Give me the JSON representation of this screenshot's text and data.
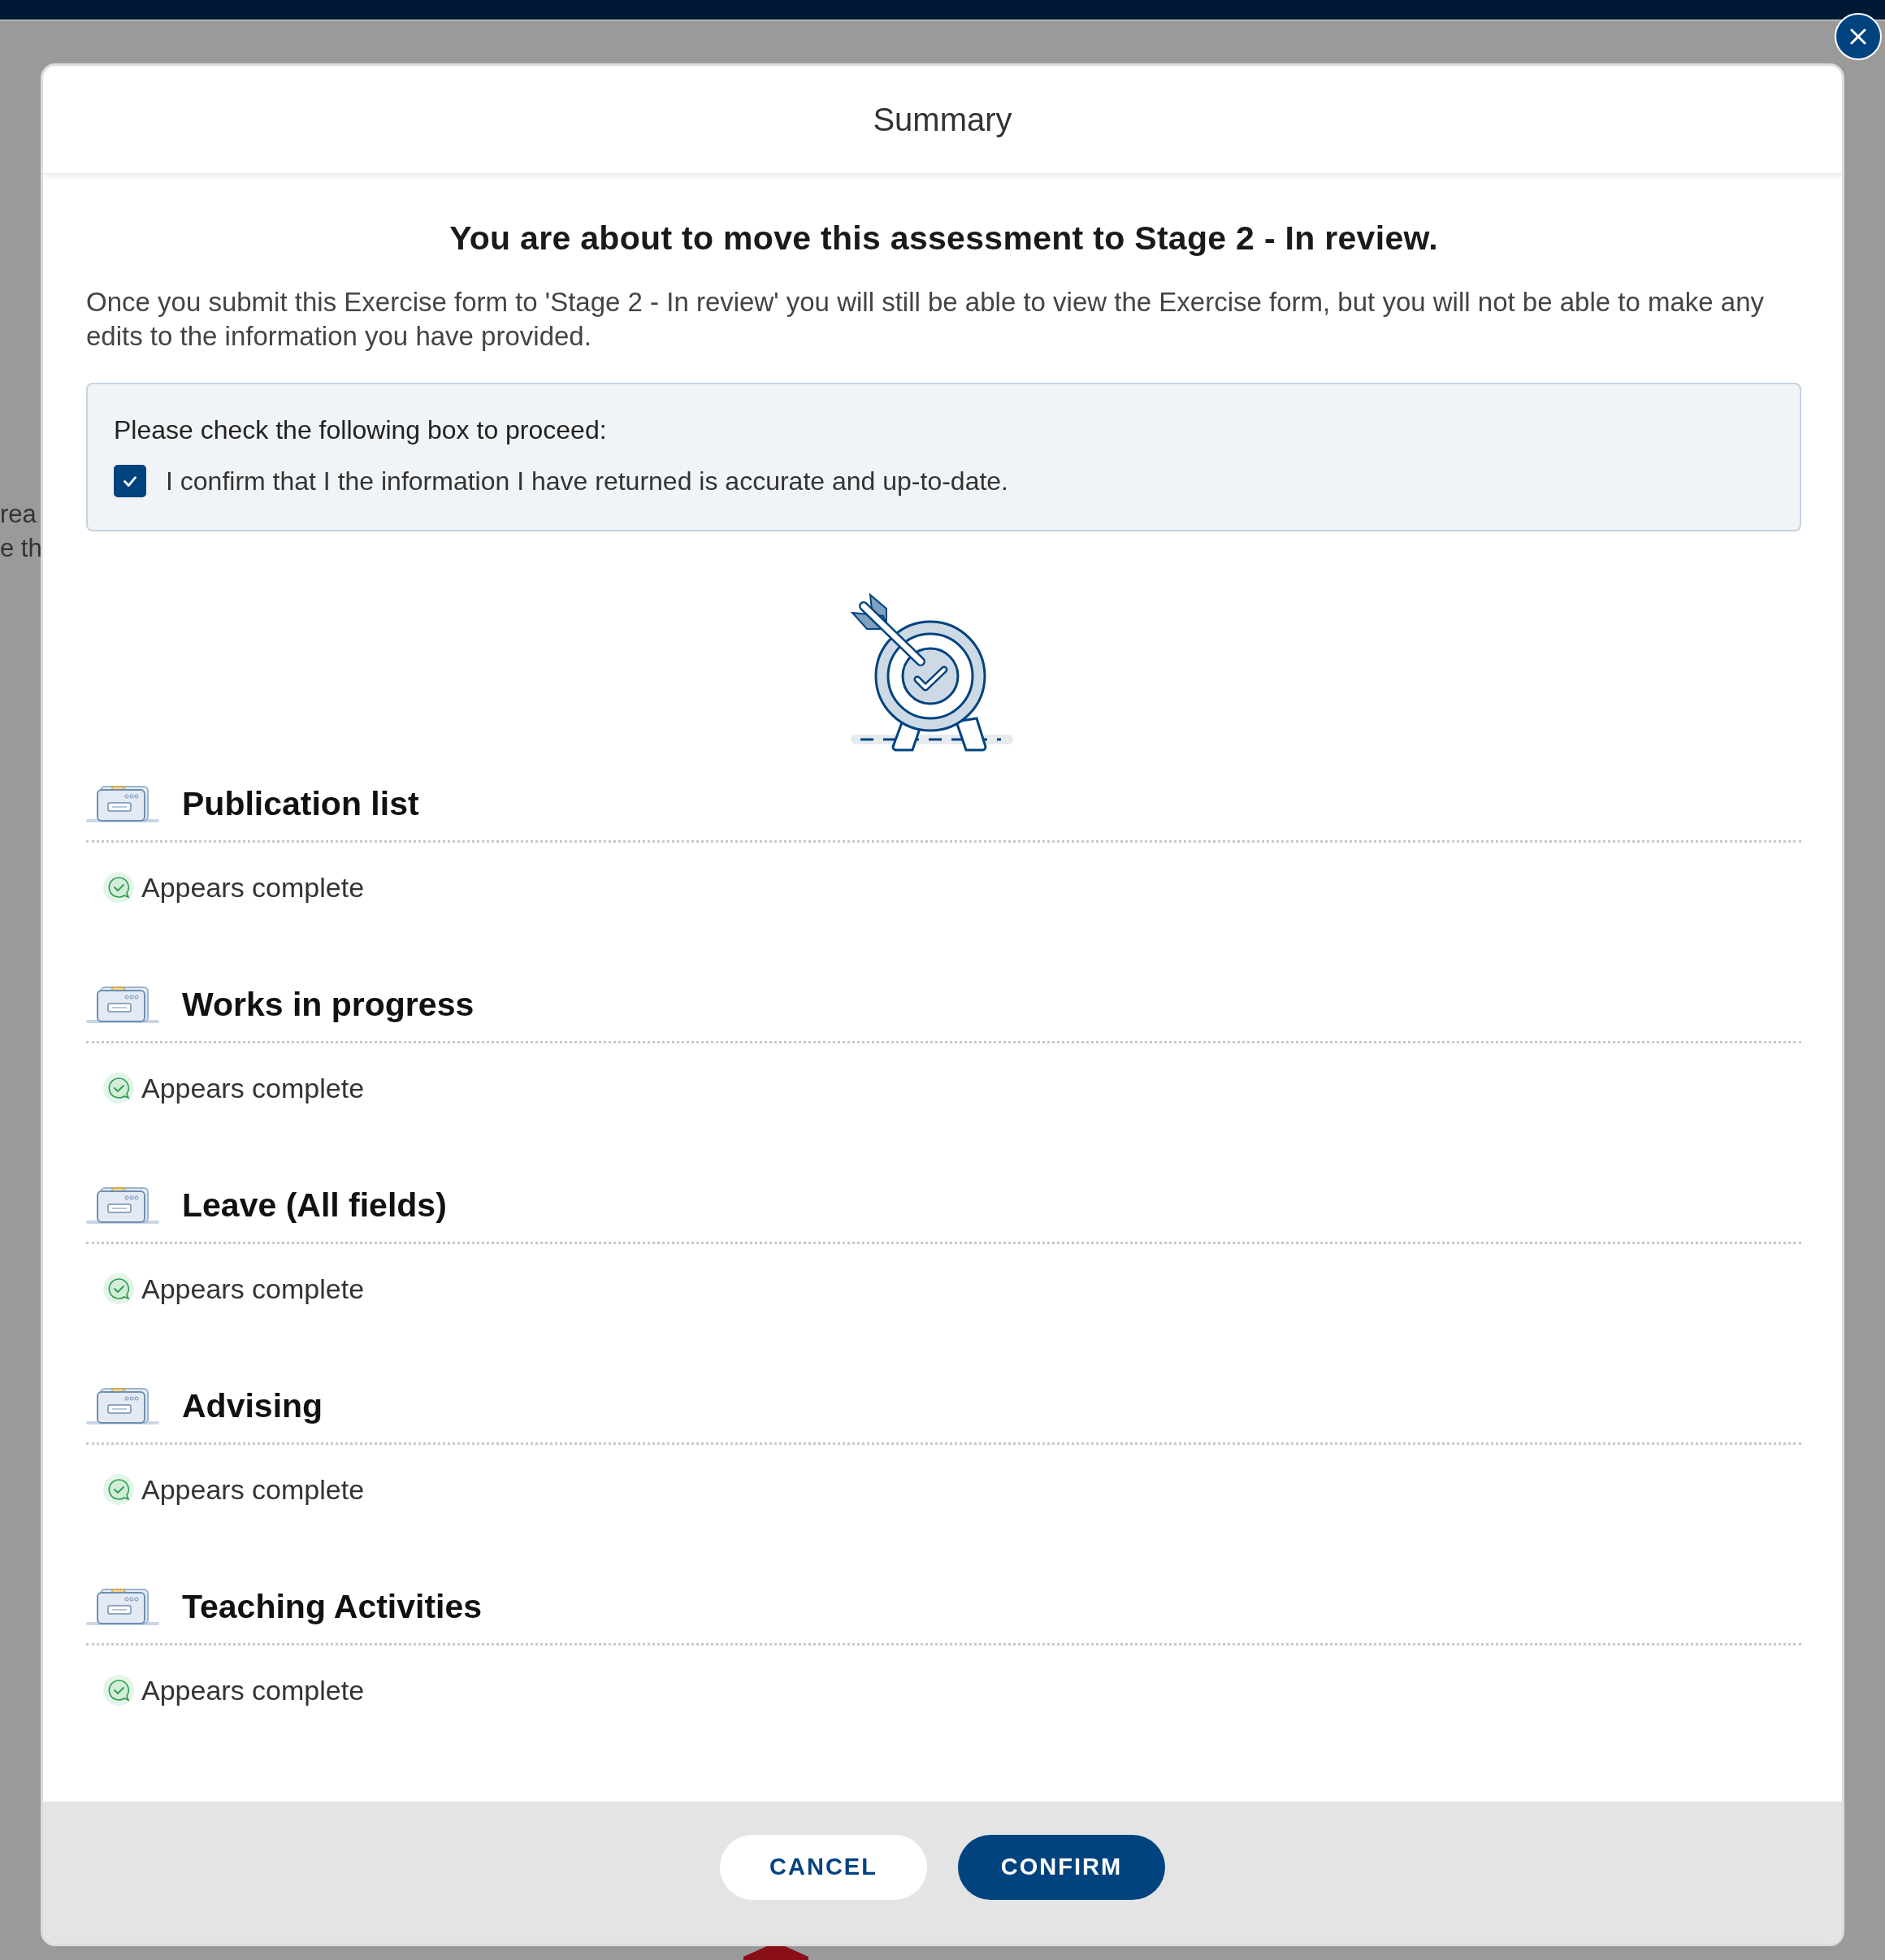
{
  "background": {
    "text_fragments": [
      "rea",
      "e th"
    ]
  },
  "dialog": {
    "title": "Summary",
    "heading": "You are about to move this assessment to Stage 2 - In review.",
    "message": "Once you submit this Exercise form to 'Stage 2 - In review' you will still be able to view the Exercise form, but you will not be able to make any edits to the information you have provided.",
    "confirm_box": {
      "prompt": "Please check the following box to proceed:",
      "checkbox": {
        "label": "I confirm that I the information I have returned is accurate and up-to-date.",
        "checked": true
      }
    },
    "sections": [
      {
        "title": "Publication list",
        "status": "Appears complete",
        "complete": true
      },
      {
        "title": "Works in progress",
        "status": "Appears complete",
        "complete": true
      },
      {
        "title": "Leave (All fields)",
        "status": "Appears complete",
        "complete": true
      },
      {
        "title": "Advising",
        "status": "Appears complete",
        "complete": true
      },
      {
        "title": "Teaching Activities",
        "status": "Appears complete",
        "complete": true
      }
    ],
    "buttons": [
      {
        "label": "CANCEL",
        "kind": "secondary"
      },
      {
        "label": "CONFIRM",
        "kind": "primary"
      }
    ]
  }
}
